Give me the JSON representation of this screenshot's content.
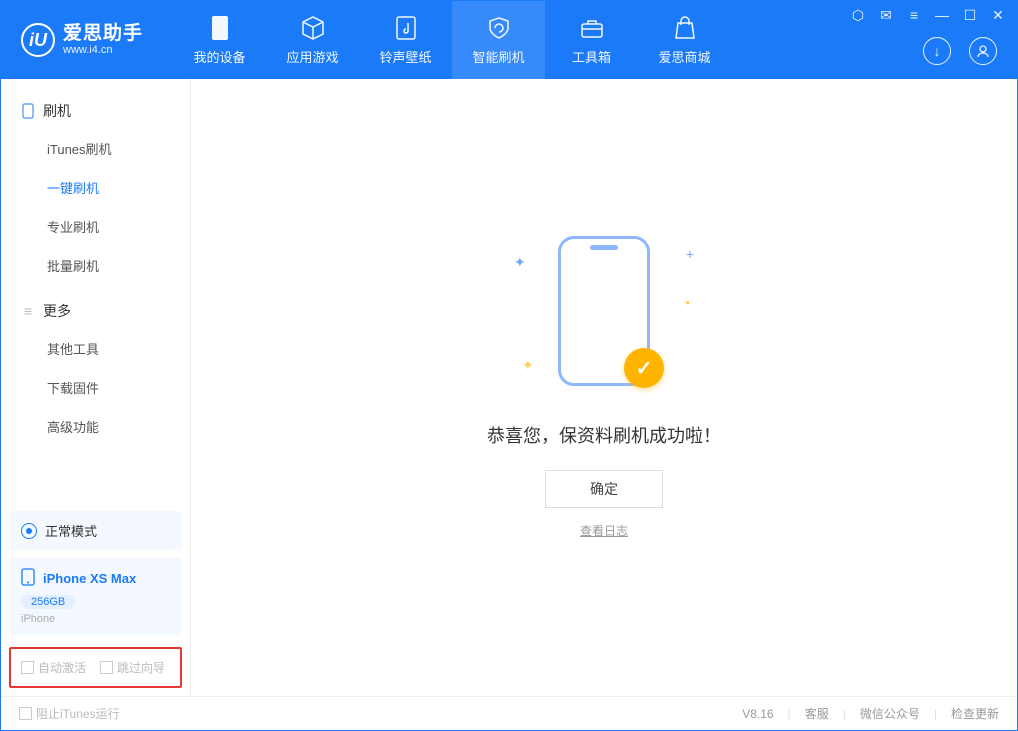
{
  "logo": {
    "title": "爱思助手",
    "sub": "www.i4.cn",
    "mark": "iU"
  },
  "nav": {
    "device": "我的设备",
    "apps": "应用游戏",
    "ringwall": "铃声壁纸",
    "flash": "智能刷机",
    "tools": "工具箱",
    "store": "爱思商城"
  },
  "sidebar": {
    "group_flash": "刷机",
    "items_flash": {
      "itunes": "iTunes刷机",
      "oneclick": "一键刷机",
      "pro": "专业刷机",
      "batch": "批量刷机"
    },
    "group_more": "更多",
    "items_more": {
      "other": "其他工具",
      "firmware": "下载固件",
      "advanced": "高级功能"
    },
    "mode_card": {
      "label": "正常模式"
    },
    "device_card": {
      "name": "iPhone XS Max",
      "capacity": "256GB",
      "type": "iPhone"
    },
    "options": {
      "auto_activate": "自动激活",
      "skip_guide": "跳过向导"
    }
  },
  "main": {
    "success": "恭喜您，保资料刷机成功啦！",
    "ok": "确定",
    "view_log": "查看日志"
  },
  "status": {
    "block_itunes": "阻止iTunes运行",
    "version": "V8.16",
    "support": "客服",
    "wechat": "微信公众号",
    "update": "检查更新"
  }
}
